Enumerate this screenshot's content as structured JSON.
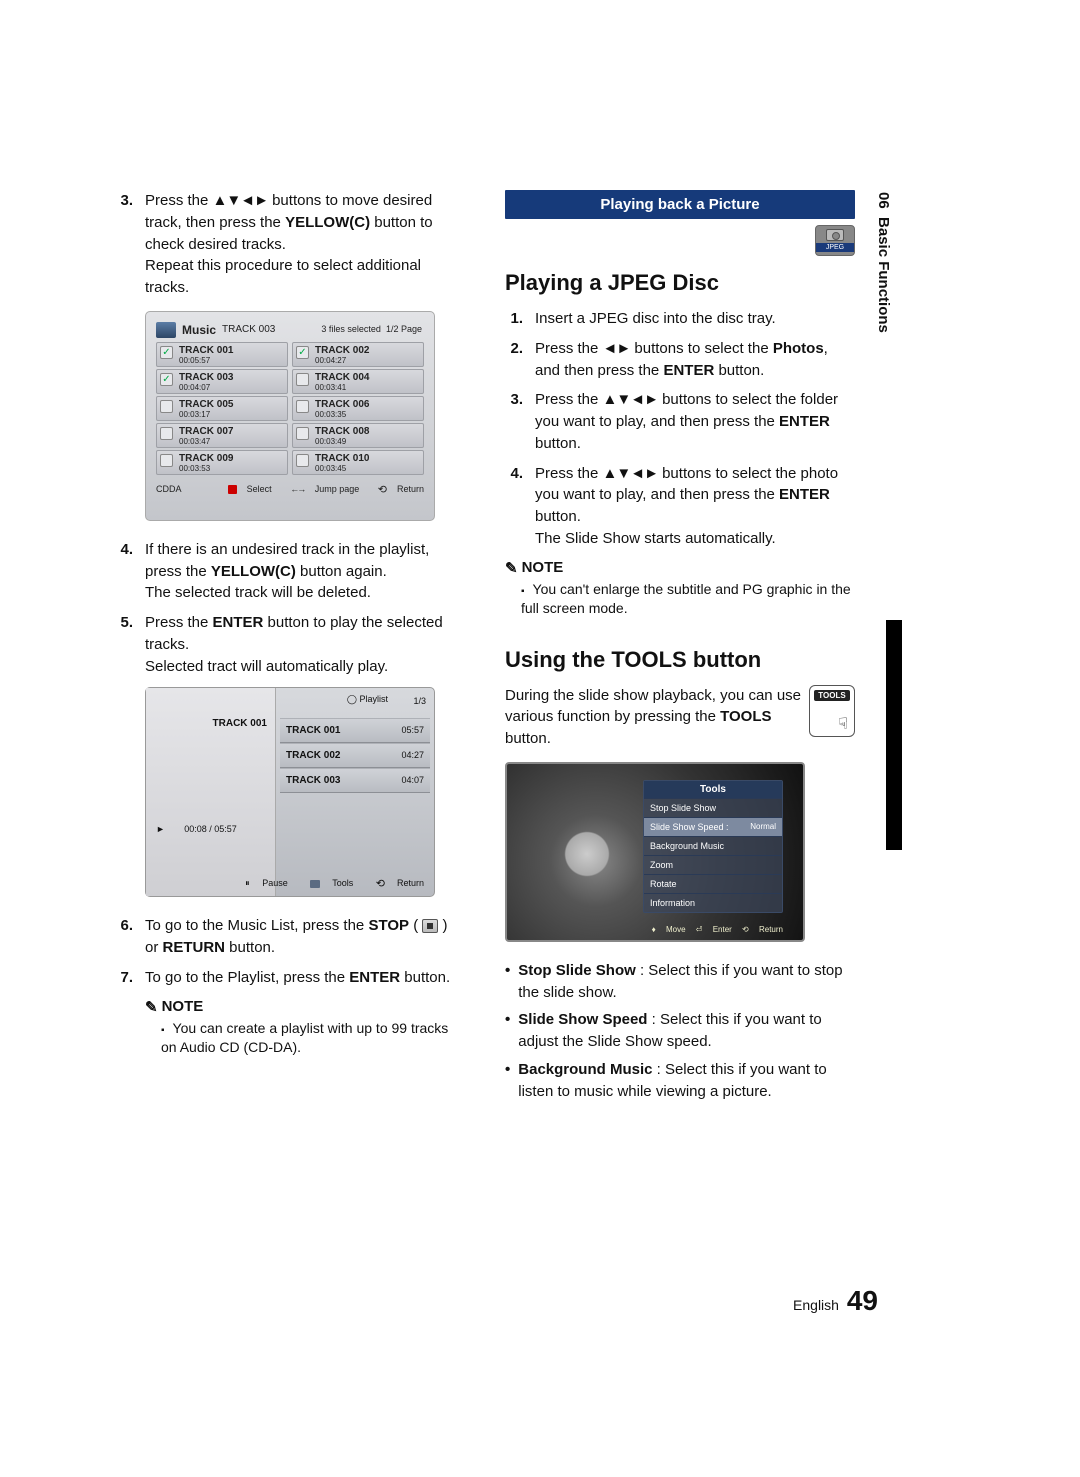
{
  "left": {
    "step3_a": "Press the ",
    "arrows4": "▲▼◄►",
    "step3_b": " buttons to move desired track, then press the ",
    "yellow": "YELLOW(C)",
    "step3_c": " button to check desired tracks.",
    "step3_d": "Repeat this procedure to select additional tracks.",
    "step4_a": "If there is an undesired track in the playlist, press the ",
    "step4_b": " button again.",
    "step4_c": "The selected track will be deleted.",
    "step5_a": "Press the ",
    "enter": "ENTER",
    "step5_b": " button to play the selected tracks.",
    "step5_c": "Selected tract will automatically play.",
    "step6_a": "To go to the Music List, press the ",
    "stop": "STOP",
    "step6_b": " or ",
    "return": "RETURN",
    "step6_c": " button.",
    "step7_a": "To go to the Playlist, press the ",
    "step7_b": " button.",
    "note": "NOTE",
    "note1": "You can create a playlist with up to 99 tracks on Audio CD (CD-DA)."
  },
  "shot1": {
    "title": "Music",
    "subtitle": "TRACK 003",
    "sel": "3 files selected",
    "page": "1/2 Page",
    "cdda": "CDDA",
    "select": "Select",
    "jump": "Jump page",
    "return": "Return",
    "left_tracks": [
      {
        "n": "TRACK 001",
        "d": "00:05:57",
        "c": true
      },
      {
        "n": "TRACK 003",
        "d": "00:04:07",
        "c": true
      },
      {
        "n": "TRACK 005",
        "d": "00:03:17",
        "c": false
      },
      {
        "n": "TRACK 007",
        "d": "00:03:47",
        "c": false
      },
      {
        "n": "TRACK 009",
        "d": "00:03:53",
        "c": false
      }
    ],
    "right_tracks": [
      {
        "n": "TRACK 002",
        "d": "00:04:27",
        "c": true
      },
      {
        "n": "TRACK 004",
        "d": "00:03:41",
        "c": false
      },
      {
        "n": "TRACK 006",
        "d": "00:03:35",
        "c": false
      },
      {
        "n": "TRACK 008",
        "d": "00:03:49",
        "c": false
      },
      {
        "n": "TRACK 010",
        "d": "00:03:45",
        "c": false
      }
    ]
  },
  "shot2": {
    "playlist": "Playlist",
    "page": "1/3",
    "cur": "TRACK 001",
    "progress": "00:08 / 05:57",
    "rows": [
      {
        "n": "TRACK 001",
        "d": "05:57"
      },
      {
        "n": "TRACK 002",
        "d": "04:27"
      },
      {
        "n": "TRACK 003",
        "d": "04:07"
      }
    ],
    "pause": "Pause",
    "tools": "Tools",
    "return": "Return"
  },
  "right": {
    "section": "Playing back a Picture",
    "badge": "JPEG",
    "h2a": "Playing a JPEG Disc",
    "s1": "Insert a JPEG disc into the disc tray.",
    "s2a": "Press the ",
    "lr": "◄►",
    "s2b": " buttons to select the ",
    "photos": "Photos",
    "s2c": ", and then press the ",
    "s2d": " button.",
    "s3a": "Press the ",
    "arrows4": "▲▼◄►",
    "s3b": " buttons to select the folder you want to play, and then press the ",
    "s3c": " button.",
    "s4a": "Press the ",
    "s4b": " buttons to select the photo you want to play, and then press the ",
    "s4c": " button.",
    "s4d": "The Slide Show starts automatically.",
    "note": "NOTE",
    "note1": "You can't enlarge the subtitle and PG graphic in the full screen mode.",
    "h2b": "Using the TOOLS button",
    "tools_p1": "During the slide show playback, you can use various function by pressing the ",
    "tools": "TOOLS",
    "tools_p2": " button.",
    "tools_label": "TOOLS"
  },
  "shot3": {
    "title": "Tools",
    "rows": [
      {
        "n": "Stop Slide Show",
        "v": ""
      },
      {
        "n": "Slide Show Speed :",
        "v": "Normal"
      },
      {
        "n": "Background Music",
        "v": ""
      },
      {
        "n": "Zoom",
        "v": ""
      },
      {
        "n": "Rotate",
        "v": ""
      },
      {
        "n": "Information",
        "v": ""
      }
    ],
    "move": "Move",
    "enter": "Enter",
    "return": "Return"
  },
  "bullets": {
    "b1a": "Stop Slide Show",
    "b1b": " : Select this if you want to stop the slide show.",
    "b2a": "Slide Show Speed",
    "b2b": " : Select this if you want to adjust the Slide Show speed.",
    "b3a": "Background Music",
    "b3b": " : Select this if you want to listen to music while viewing a picture."
  },
  "sidebar": {
    "num": "06",
    "label": "Basic Functions"
  },
  "footer": {
    "lang": "English",
    "page": "49"
  }
}
